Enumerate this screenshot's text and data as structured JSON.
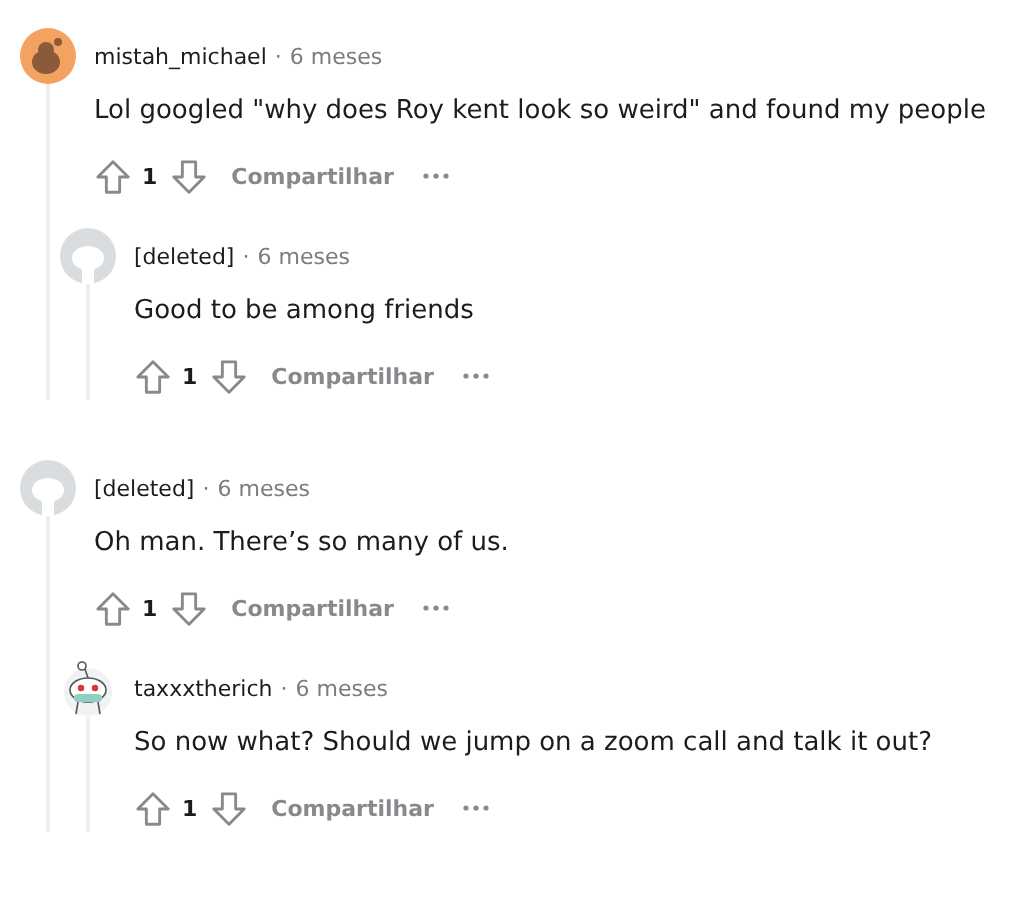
{
  "comments": [
    {
      "kind": "orange",
      "author": "mistah_michael",
      "separator": "·",
      "time": "6 meses",
      "body": "Lol googled \"why does Roy kent look so weird\" and found my people",
      "score": "1",
      "share": "Compartilhar",
      "children": [
        {
          "kind": "deleted",
          "author": "[deleted]",
          "separator": "·",
          "time": "6 meses",
          "body": "Good to be among friends",
          "score": "1",
          "share": "Compartilhar"
        }
      ]
    },
    {
      "kind": "deleted",
      "author": "[deleted]",
      "separator": "·",
      "time": "6 meses",
      "body": "Oh man. There’s so many of us.",
      "score": "1",
      "share": "Compartilhar",
      "children": [
        {
          "kind": "snoo",
          "author": "taxxxtherich",
          "separator": "·",
          "time": "6 meses",
          "body": "So now what? Should we jump on a zoom call and talk it out?",
          "score": "1",
          "share": "Compartilhar"
        }
      ]
    }
  ]
}
